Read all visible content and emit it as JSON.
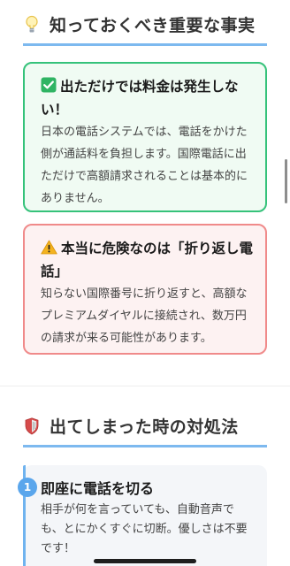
{
  "section1": {
    "icon": "lightbulb-icon",
    "title": "知っておくべき重要な事実"
  },
  "card_green": {
    "badge_icon": "check-badge-icon",
    "title": "出ただけでは料金は発生しない！",
    "text": "日本の電話システムでは、電話をかけた側が通話料を負担します。国際電話に出ただけで高額請求されることは基本的にありません。"
  },
  "card_red": {
    "badge_icon": "warning-icon",
    "title": "本当に危険なのは「折り返し電話」",
    "text": "知らない国際番号に折り返すと、高額なプレミアムダイヤルに接続され、数万円の請求が来る可能性があります。"
  },
  "section2": {
    "icon": "shield-icon",
    "title": "出てしまった時の対処法"
  },
  "step1": {
    "number": "1",
    "title": "即座に電話を切る",
    "text": "相手が何を言っていても、自動音声でも、とにかくすぐに切断。優しさは不要です！"
  },
  "colors": {
    "accent_blue": "#7db9ef",
    "green_border": "#35c27a",
    "red_border": "#f08a8a"
  }
}
